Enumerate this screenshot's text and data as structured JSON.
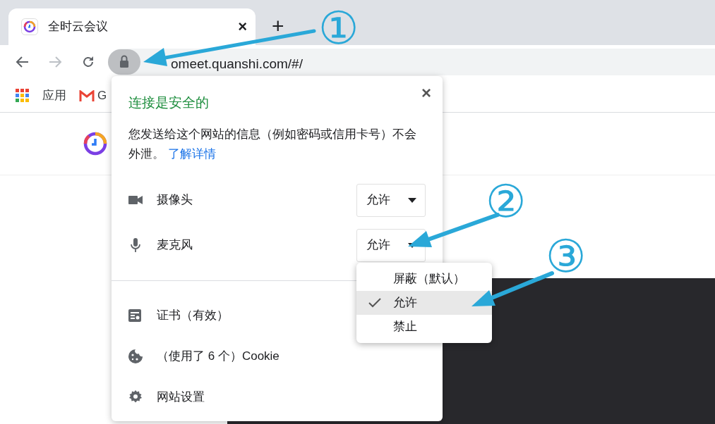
{
  "tab": {
    "title": "全时云会议",
    "close": "×"
  },
  "new_tab": "+",
  "address_bar": {
    "url": "omeet.quanshi.com/#/"
  },
  "bookmarks": [
    {
      "kind": "apps",
      "label": "应用"
    },
    {
      "kind": "gmail",
      "label": "G"
    }
  ],
  "popup": {
    "title": "连接是安全的",
    "close": "×",
    "description": "您发送给这个网站的信息（例如密码或信用卡号）不会外泄。",
    "learn_more": "了解详情",
    "permissions": [
      {
        "kind": "camera",
        "label": "摄像头",
        "value": "允许"
      },
      {
        "kind": "microphone",
        "label": "麦克风",
        "value": "允许"
      }
    ],
    "links": [
      {
        "kind": "certificate",
        "label": "证书（有效）"
      },
      {
        "kind": "cookie",
        "label": "（使用了 6 个）Cookie"
      },
      {
        "kind": "settings",
        "label": "网站设置"
      }
    ]
  },
  "dropdown": {
    "options": [
      {
        "label": "屏蔽（默认）",
        "selected": false
      },
      {
        "label": "允许",
        "selected": true
      },
      {
        "label": "禁止",
        "selected": false
      }
    ]
  },
  "annotations": [
    {
      "label": "①"
    },
    {
      "label": "②"
    },
    {
      "label": "③"
    }
  ]
}
